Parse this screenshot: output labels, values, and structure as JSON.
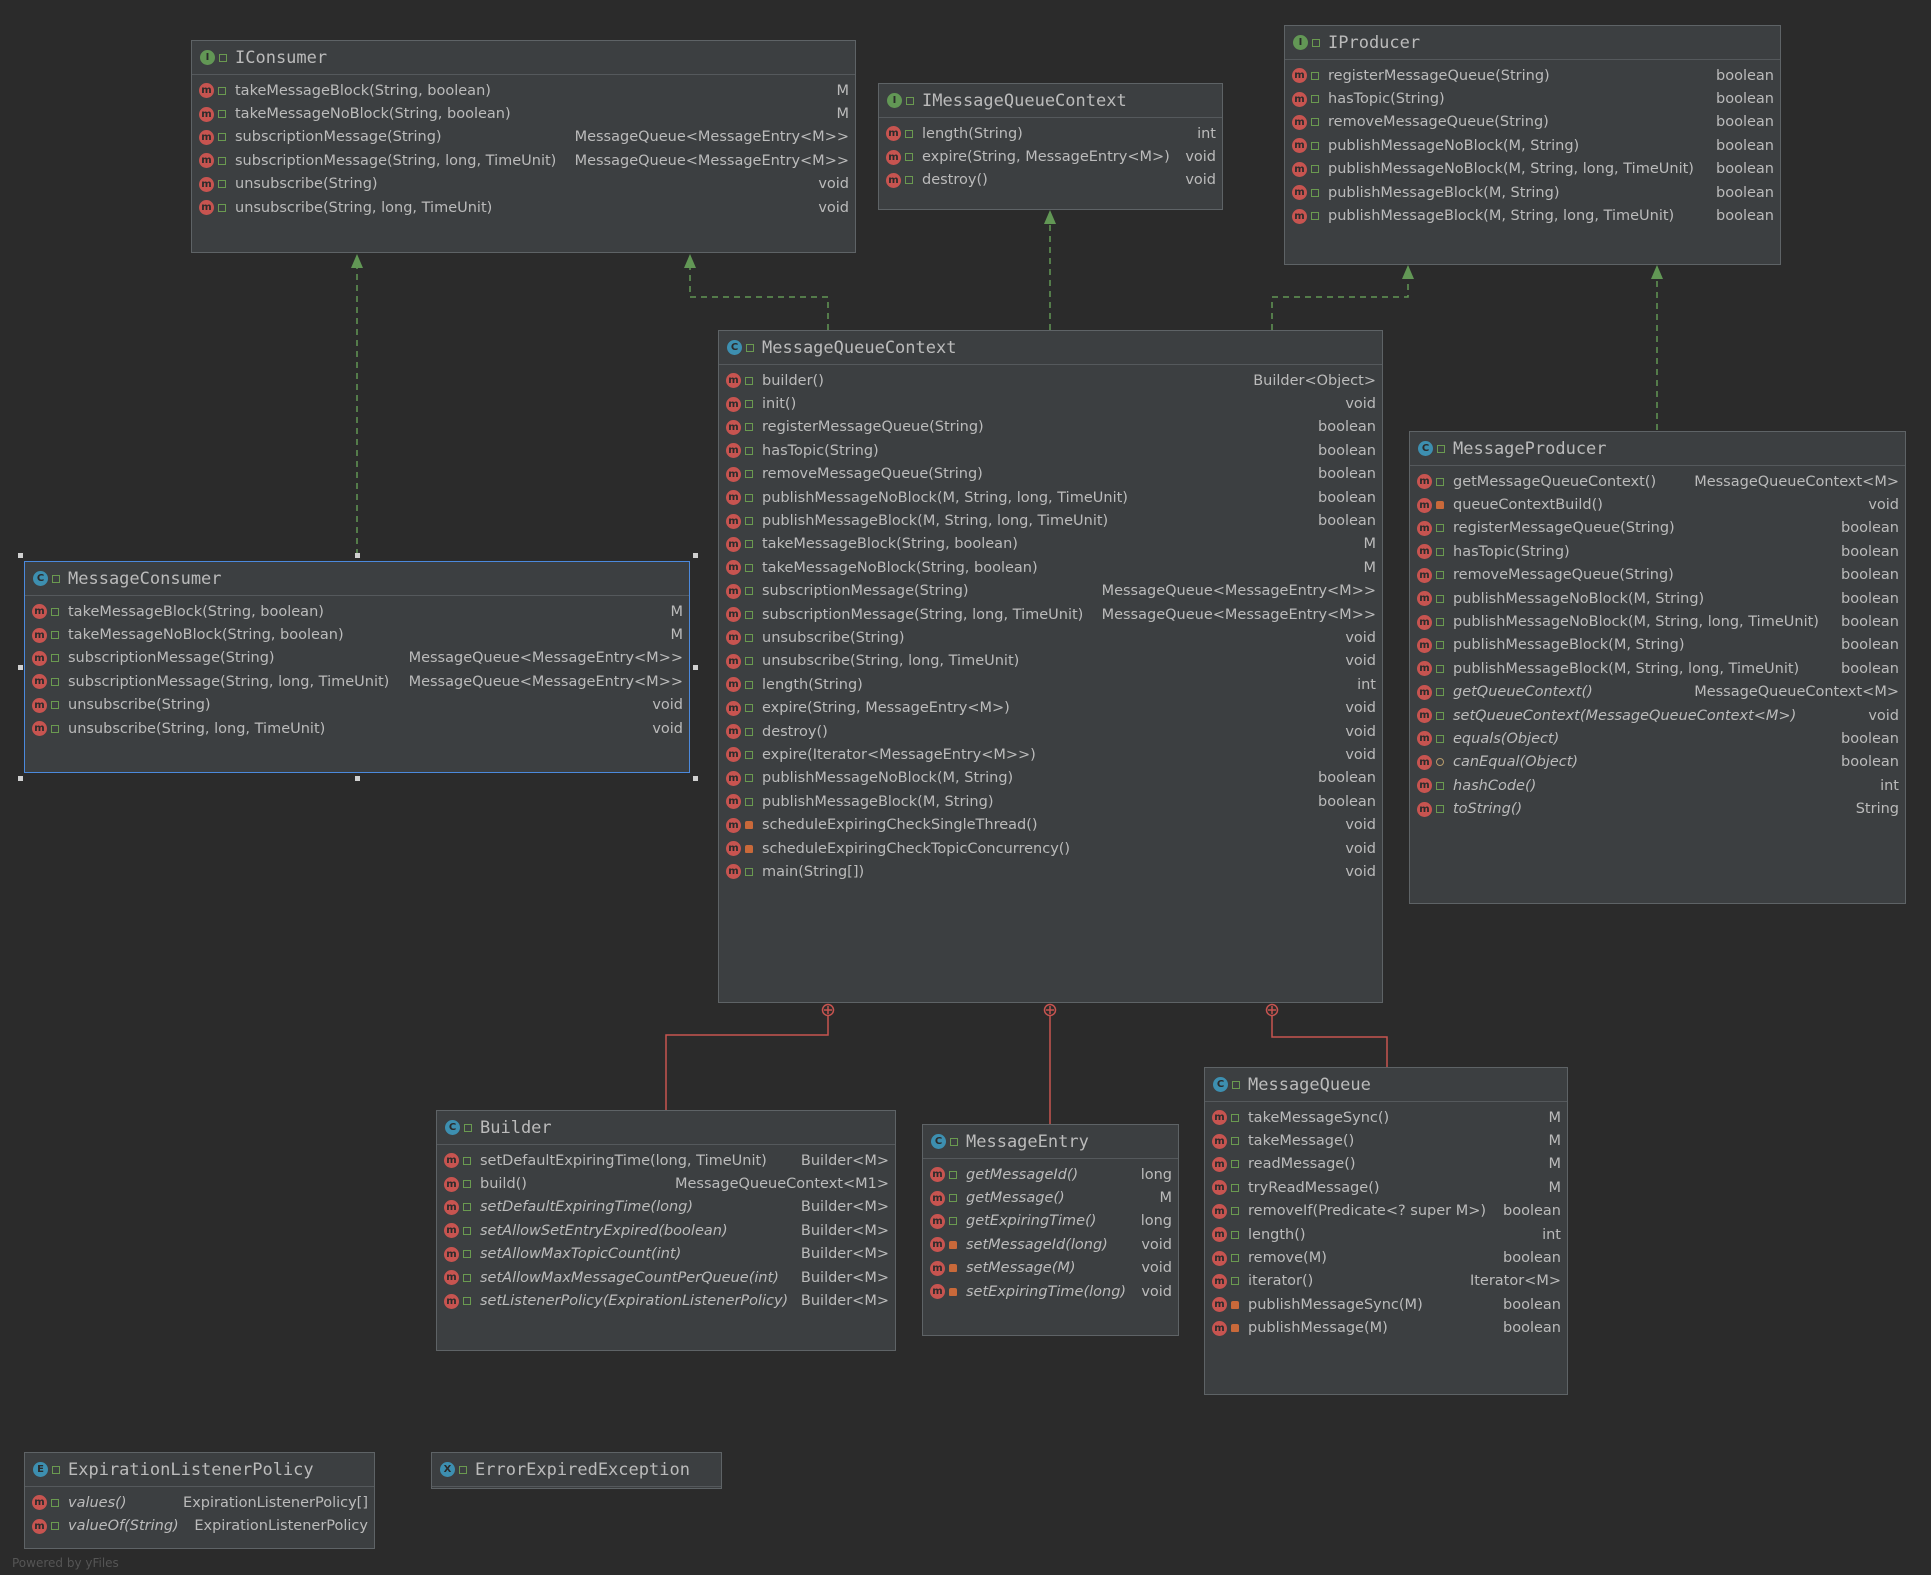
{
  "footer_text": "Powered by yFiles",
  "colors": {
    "background": "#2b2b2b",
    "implements_edge": "#629755",
    "inner_edge": "#c75450",
    "selection": "#4b89dc"
  },
  "classes": {
    "iconsumer": {
      "name": "IConsumer",
      "kind": "I",
      "icon": "interface-icon",
      "rows": [
        {
          "sig": "takeMessageBlock(String, boolean)",
          "ret": "M"
        },
        {
          "sig": "takeMessageNoBlock(String, boolean)",
          "ret": "M"
        },
        {
          "sig": "subscriptionMessage(String)",
          "ret": "MessageQueue<MessageEntry<M>>"
        },
        {
          "sig": "subscriptionMessage(String, long, TimeUnit)",
          "ret": "MessageQueue<MessageEntry<M>>"
        },
        {
          "sig": "unsubscribe(String)",
          "ret": "void"
        },
        {
          "sig": "unsubscribe(String, long, TimeUnit)",
          "ret": "void"
        }
      ]
    },
    "imqctx": {
      "name": "IMessageQueueContext",
      "kind": "I",
      "icon": "interface-icon",
      "rows": [
        {
          "sig": "length(String)",
          "ret": "int"
        },
        {
          "sig": "expire(String, MessageEntry<M>)",
          "ret": "void"
        },
        {
          "sig": "destroy()",
          "ret": "void"
        }
      ]
    },
    "iproducer": {
      "name": "IProducer",
      "kind": "I",
      "icon": "interface-icon",
      "rows": [
        {
          "sig": "registerMessageQueue(String)",
          "ret": "boolean"
        },
        {
          "sig": "hasTopic(String)",
          "ret": "boolean"
        },
        {
          "sig": "removeMessageQueue(String)",
          "ret": "boolean"
        },
        {
          "sig": "publishMessageNoBlock(M, String)",
          "ret": "boolean"
        },
        {
          "sig": "publishMessageNoBlock(M, String, long, TimeUnit)",
          "ret": "boolean"
        },
        {
          "sig": "publishMessageBlock(M, String)",
          "ret": "boolean"
        },
        {
          "sig": "publishMessageBlock(M, String, long, TimeUnit)",
          "ret": "boolean"
        }
      ]
    },
    "mqctx": {
      "name": "MessageQueueContext",
      "kind": "C",
      "icon": "class-icon",
      "rows": [
        {
          "sig": "builder()",
          "ret": "Builder<Object>"
        },
        {
          "sig": "init()",
          "ret": "void"
        },
        {
          "sig": "registerMessageQueue(String)",
          "ret": "boolean"
        },
        {
          "sig": "hasTopic(String)",
          "ret": "boolean"
        },
        {
          "sig": "removeMessageQueue(String)",
          "ret": "boolean"
        },
        {
          "sig": "publishMessageNoBlock(M, String, long, TimeUnit)",
          "ret": "boolean"
        },
        {
          "sig": "publishMessageBlock(M, String, long, TimeUnit)",
          "ret": "boolean"
        },
        {
          "sig": "takeMessageBlock(String, boolean)",
          "ret": "M"
        },
        {
          "sig": "takeMessageNoBlock(String, boolean)",
          "ret": "M"
        },
        {
          "sig": "subscriptionMessage(String)",
          "ret": "MessageQueue<MessageEntry<M>>"
        },
        {
          "sig": "subscriptionMessage(String, long, TimeUnit)",
          "ret": "MessageQueue<MessageEntry<M>>"
        },
        {
          "sig": "unsubscribe(String)",
          "ret": "void"
        },
        {
          "sig": "unsubscribe(String, long, TimeUnit)",
          "ret": "void"
        },
        {
          "sig": "length(String)",
          "ret": "int"
        },
        {
          "sig": "expire(String, MessageEntry<M>)",
          "ret": "void"
        },
        {
          "sig": "destroy()",
          "ret": "void"
        },
        {
          "sig": "expire(Iterator<MessageEntry<M>>)",
          "ret": "void"
        },
        {
          "sig": "publishMessageNoBlock(M, String)",
          "ret": "boolean"
        },
        {
          "sig": "publishMessageBlock(M, String)",
          "ret": "boolean"
        },
        {
          "sig": "scheduleExpiringCheckSingleThread()",
          "ret": "void",
          "private": true
        },
        {
          "sig": "scheduleExpiringCheckTopicConcurrency()",
          "ret": "void",
          "private": true
        },
        {
          "sig": "main(String[])",
          "ret": "void"
        }
      ]
    },
    "consumer": {
      "name": "MessageConsumer",
      "kind": "C",
      "icon": "class-icon",
      "rows": [
        {
          "sig": "takeMessageBlock(String, boolean)",
          "ret": "M"
        },
        {
          "sig": "takeMessageNoBlock(String, boolean)",
          "ret": "M"
        },
        {
          "sig": "subscriptionMessage(String)",
          "ret": "MessageQueue<MessageEntry<M>>"
        },
        {
          "sig": "subscriptionMessage(String, long, TimeUnit)",
          "ret": "MessageQueue<MessageEntry<M>>"
        },
        {
          "sig": "unsubscribe(String)",
          "ret": "void"
        },
        {
          "sig": "unsubscribe(String, long, TimeUnit)",
          "ret": "void"
        }
      ]
    },
    "producer": {
      "name": "MessageProducer",
      "kind": "C",
      "icon": "class-icon",
      "rows": [
        {
          "sig": "getMessageQueueContext()",
          "ret": "MessageQueueContext<M>"
        },
        {
          "sig": "queueContextBuild()",
          "ret": "void",
          "private": true
        },
        {
          "sig": "registerMessageQueue(String)",
          "ret": "boolean"
        },
        {
          "sig": "hasTopic(String)",
          "ret": "boolean"
        },
        {
          "sig": "removeMessageQueue(String)",
          "ret": "boolean"
        },
        {
          "sig": "publishMessageNoBlock(M, String)",
          "ret": "boolean"
        },
        {
          "sig": "publishMessageNoBlock(M, String, long, TimeUnit)",
          "ret": "boolean"
        },
        {
          "sig": "publishMessageBlock(M, String)",
          "ret": "boolean"
        },
        {
          "sig": "publishMessageBlock(M, String, long, TimeUnit)",
          "ret": "boolean"
        },
        {
          "sig": "getQueueContext()",
          "ret": "MessageQueueContext<M>",
          "italic": true
        },
        {
          "sig": "setQueueContext(MessageQueueContext<M>)",
          "ret": "void",
          "italic": true
        },
        {
          "sig": "equals(Object)",
          "ret": "boolean",
          "italic": true
        },
        {
          "sig": "canEqual(Object)",
          "ret": "boolean",
          "italic": true,
          "protected": true
        },
        {
          "sig": "hashCode()",
          "ret": "int",
          "italic": true
        },
        {
          "sig": "toString()",
          "ret": "String",
          "italic": true
        }
      ]
    },
    "builder": {
      "name": "Builder",
      "kind": "C",
      "icon": "class-icon",
      "rows": [
        {
          "sig": "setDefaultExpiringTime(long, TimeUnit)",
          "ret": "Builder<M>"
        },
        {
          "sig": "build()",
          "ret": "MessageQueueContext<M1>"
        },
        {
          "sig": "setDefaultExpiringTime(long)",
          "ret": "Builder<M>",
          "italic": true
        },
        {
          "sig": "setAllowSetEntryExpired(boolean)",
          "ret": "Builder<M>",
          "italic": true
        },
        {
          "sig": "setAllowMaxTopicCount(int)",
          "ret": "Builder<M>",
          "italic": true
        },
        {
          "sig": "setAllowMaxMessageCountPerQueue(int)",
          "ret": "Builder<M>",
          "italic": true
        },
        {
          "sig": "setListenerPolicy(ExpirationListenerPolicy)",
          "ret": "Builder<M>",
          "italic": true
        }
      ]
    },
    "entry": {
      "name": "MessageEntry",
      "kind": "C",
      "icon": "class-icon",
      "rows": [
        {
          "sig": "getMessageId()",
          "ret": "long",
          "italic": true
        },
        {
          "sig": "getMessage()",
          "ret": "M",
          "italic": true
        },
        {
          "sig": "getExpiringTime()",
          "ret": "long",
          "italic": true
        },
        {
          "sig": "setMessageId(long)",
          "ret": "void",
          "italic": true,
          "private": true
        },
        {
          "sig": "setMessage(M)",
          "ret": "void",
          "italic": true,
          "private": true
        },
        {
          "sig": "setExpiringTime(long)",
          "ret": "void",
          "italic": true,
          "private": true
        }
      ]
    },
    "queue": {
      "name": "MessageQueue",
      "kind": "C",
      "icon": "class-icon",
      "rows": [
        {
          "sig": "takeMessageSync()",
          "ret": "M"
        },
        {
          "sig": "takeMessage()",
          "ret": "M"
        },
        {
          "sig": "readMessage()",
          "ret": "M"
        },
        {
          "sig": "tryReadMessage()",
          "ret": "M"
        },
        {
          "sig": "removeIf(Predicate<? super M>)",
          "ret": "boolean"
        },
        {
          "sig": "length()",
          "ret": "int"
        },
        {
          "sig": "remove(M)",
          "ret": "boolean"
        },
        {
          "sig": "iterator()",
          "ret": "Iterator<M>"
        },
        {
          "sig": "publishMessageSync(M)",
          "ret": "boolean",
          "private": true
        },
        {
          "sig": "publishMessage(M)",
          "ret": "boolean",
          "private": true
        }
      ]
    },
    "policy": {
      "name": "ExpirationListenerPolicy",
      "kind": "E",
      "icon": "enum-icon",
      "rows": [
        {
          "sig": "values()",
          "ret": "ExpirationListenerPolicy[]",
          "italic": true
        },
        {
          "sig": "valueOf(String)",
          "ret": "ExpirationListenerPolicy",
          "italic": true
        }
      ]
    },
    "error": {
      "name": "ErrorExpiredException",
      "kind": "X",
      "icon": "exception-class-icon",
      "rows": []
    }
  }
}
